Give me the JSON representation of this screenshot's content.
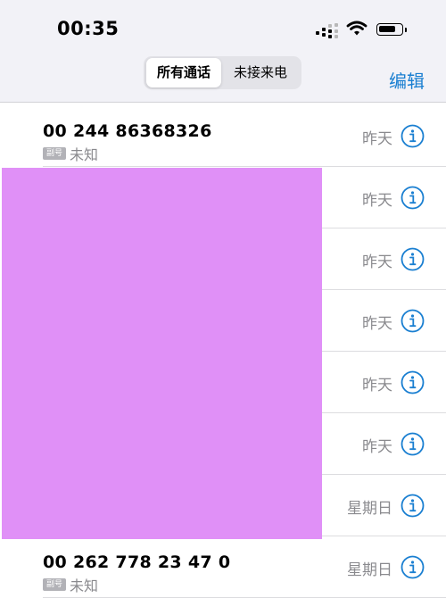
{
  "status_bar": {
    "time": "00:35"
  },
  "nav": {
    "tabs": [
      {
        "label": "所有通话",
        "selected": true
      },
      {
        "label": "未接来电",
        "selected": false
      }
    ],
    "edit_label": "编辑"
  },
  "colors": {
    "accent": "#1a7fd1",
    "secondary_text": "#8a8a8e",
    "redaction": "#e090f7"
  },
  "calls": [
    {
      "number": "00 244 86368326",
      "sim": "副号",
      "type": "未知",
      "date": "昨天"
    },
    {
      "number": "",
      "sim": "",
      "type": "",
      "date": "昨天"
    },
    {
      "number": "",
      "sim": "",
      "type": "",
      "date": "昨天"
    },
    {
      "number": "",
      "sim": "",
      "type": "",
      "date": "昨天"
    },
    {
      "number": "",
      "sim": "",
      "type": "",
      "date": "昨天"
    },
    {
      "number": "",
      "sim": "",
      "type": "",
      "date": "昨天"
    },
    {
      "number": "",
      "sim": "",
      "type": "",
      "date": "星期日"
    },
    {
      "number": "00 262 778 23 47 0",
      "sim": "副号",
      "type": "未知",
      "date": "星期日"
    }
  ]
}
